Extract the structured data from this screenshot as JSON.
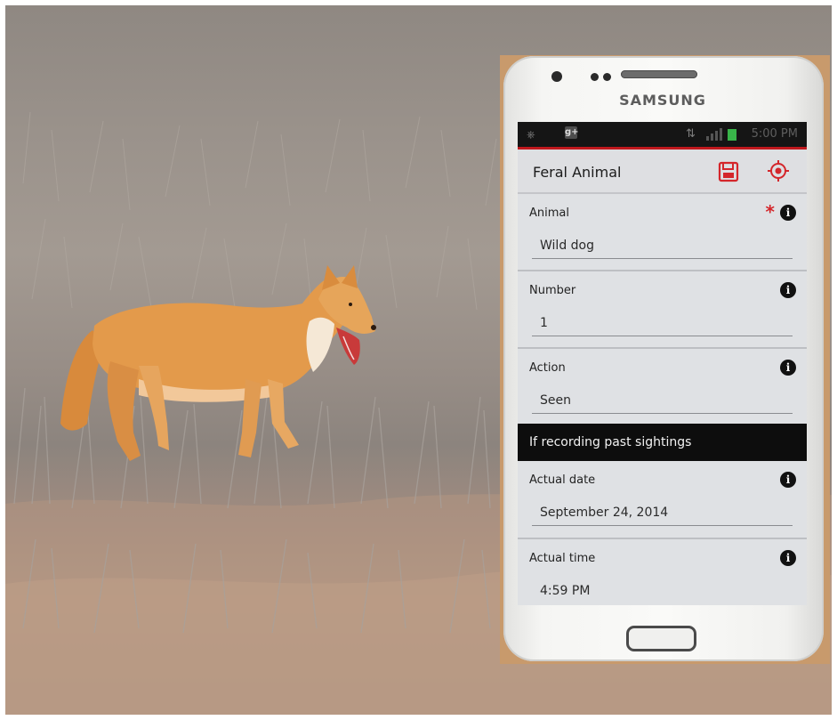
{
  "phone": {
    "brand": "SAMSUNG"
  },
  "status_bar": {
    "time": "5:00 PM",
    "icons": [
      "signal-icon",
      "battery-icon",
      "google-plus-icon",
      "usb-icon"
    ]
  },
  "app": {
    "title": "Feral Animal",
    "actions": [
      "save-icon",
      "location-target-icon"
    ],
    "accent_color": "#d4262b"
  },
  "fields": [
    {
      "label": "Animal",
      "value": "Wild dog",
      "required": true
    },
    {
      "label": "Number",
      "value": "1",
      "required": false
    },
    {
      "label": "Action",
      "value": "Seen",
      "required": false
    }
  ],
  "section": {
    "title": "If recording past sightings"
  },
  "past_fields": [
    {
      "label": "Actual date",
      "value": "September 24, 2014"
    },
    {
      "label": "Actual time",
      "value": "4:59 PM"
    }
  ],
  "info_glyph": "i",
  "required_glyph": "*"
}
